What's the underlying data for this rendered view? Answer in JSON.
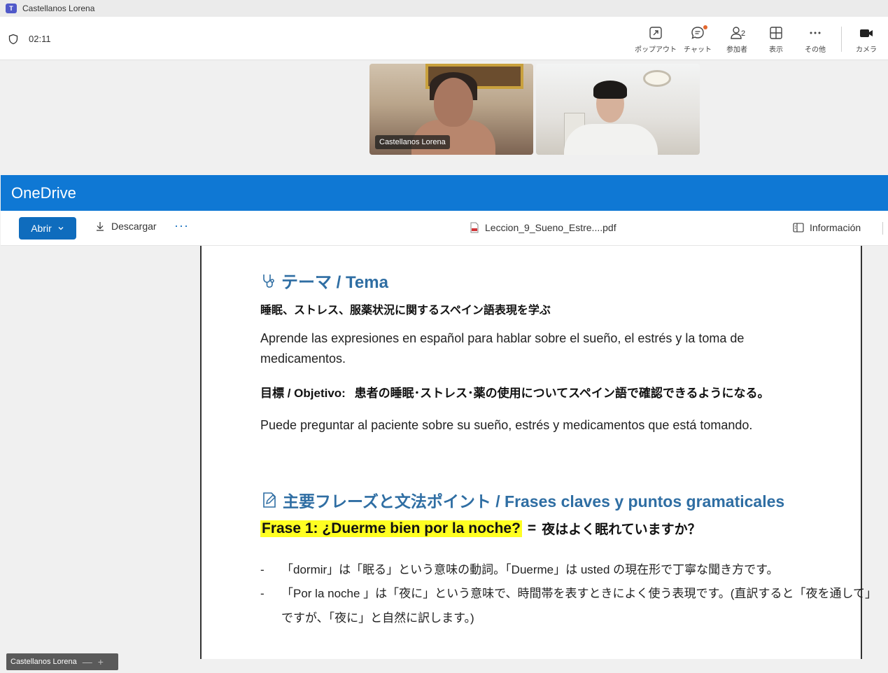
{
  "window": {
    "title": "Castellanos Lorena"
  },
  "meeting": {
    "timer": "02:11",
    "toolbar": {
      "popout": "ポップアウト",
      "chat": "チャット",
      "participants": "参加者",
      "participants_count": "2",
      "view": "表示",
      "more": "その他",
      "camera": "カメラ"
    },
    "videos": [
      {
        "name": "Castellanos Lorena"
      },
      {
        "name": ""
      }
    ],
    "self_tag": "Castellanos Lorena"
  },
  "onedrive": {
    "brand": "OneDrive",
    "open_label": "Abrir",
    "download_label": "Descargar",
    "more_label": "···",
    "filename": "Leccion_9_Sueno_Estre....pdf",
    "info_label": "Información"
  },
  "pdf": {
    "tema_heading": "テーマ / Tema",
    "tema_jp": "睡眠、ストレス、服薬状況に関するスペイン語表現を学ぶ",
    "tema_es": "Aprende las expresiones en español para hablar sobre el sueño, el estrés y la toma de medicamentos.",
    "objetivo_label": "目標 / Objetivo:",
    "objetivo_jp": "患者の睡眠･ストレス･薬の使用についてスペイン語で確認できるようになる。",
    "objetivo_es": "Puede preguntar al paciente sobre su sueño, estrés y medicamentos que está tomando.",
    "frases_heading": "主要フレーズと文法ポイント / Frases claves y puntos gramaticales",
    "frase1_es": "Frase 1: ¿Duerme bien por la noche?",
    "frase1_eq": "=",
    "frase1_jp": "夜はよく眠れていますか？",
    "bullets": [
      "「dormir」は「眠る」という意味の動詞。「Duerme」は usted の現在形で丁寧な聞き方です。",
      "「Por la noche 」は「夜に」という意味で、時間帯を表すときによく使う表現です。(直訳すると「夜を通して」",
      "ですが、「夜に」と自然に訳します。)"
    ],
    "bullet_dash": "-"
  }
}
